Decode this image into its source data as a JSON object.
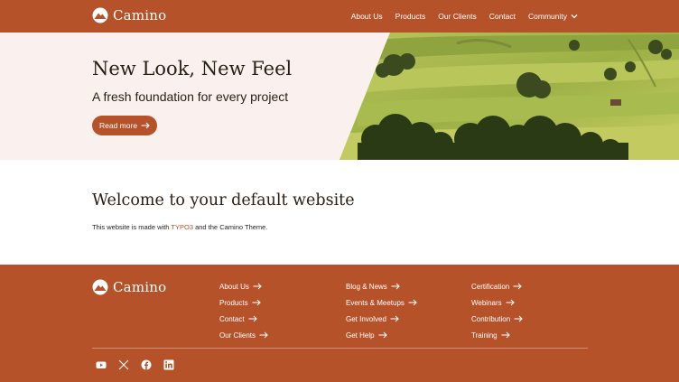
{
  "brand": {
    "name": "Camino",
    "icon": "camino-logo-icon"
  },
  "nav": {
    "items": [
      {
        "label": "About Us"
      },
      {
        "label": "Products"
      },
      {
        "label": "Our Clients"
      },
      {
        "label": "Contact"
      },
      {
        "label": "Community",
        "icon": "chevron-down-icon"
      }
    ]
  },
  "hero": {
    "title": "New Look, New Feel",
    "subtitle": "A fresh foundation for every project",
    "button_label": "Read more",
    "image": "landscape-photo"
  },
  "welcome": {
    "title": "Welcome to your default website",
    "text_before": "This website is made with ",
    "link_text": "TYPO3",
    "text_after": " and the Camino Theme."
  },
  "footer": {
    "columns": [
      [
        "About Us",
        "Products",
        "Contact",
        "Our Clients"
      ],
      [
        "Blog & News",
        "Events & Meetups",
        "Get Involved",
        "Get Help"
      ],
      [
        "Certification",
        "Webinars",
        "Contribution",
        "Training"
      ]
    ],
    "socials": [
      "youtube-icon",
      "x-icon",
      "facebook-icon",
      "linkedin-icon"
    ]
  },
  "colors": {
    "brand": "#b5522a",
    "hero_bg": "#faf1ee",
    "text": "#2a1d14"
  }
}
